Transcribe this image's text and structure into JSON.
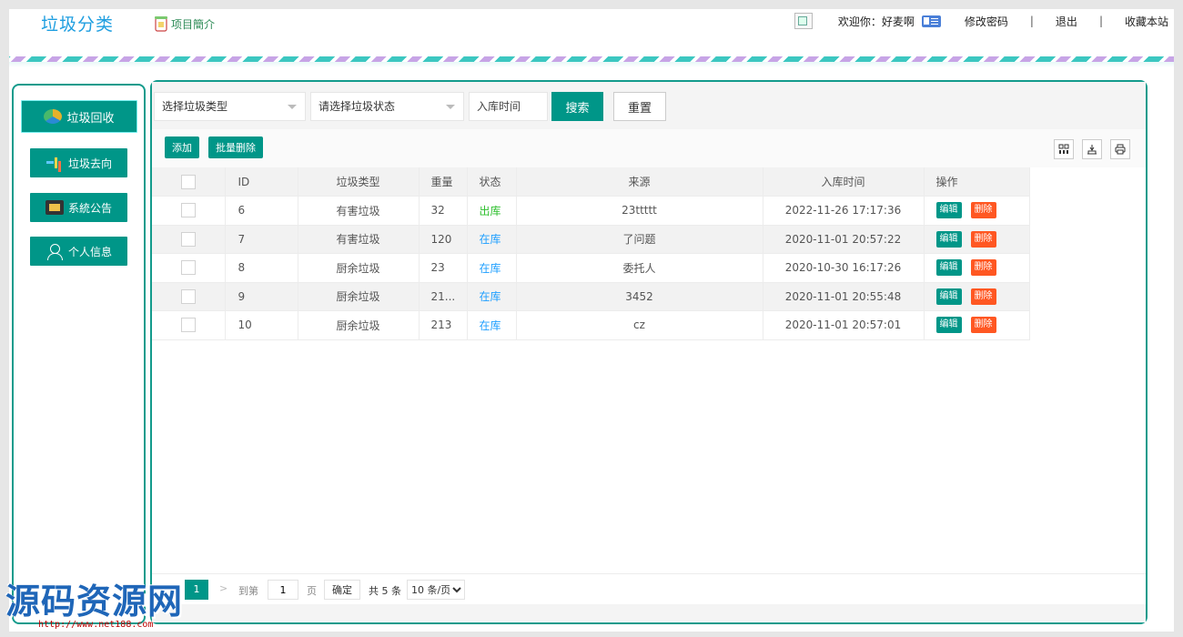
{
  "header": {
    "logo": "垃圾分类",
    "project_intro": "项目簡介",
    "welcome": "欢迎你：好麦啊",
    "change_password": "修改密码",
    "separator": "|",
    "logout": "退出",
    "bookmark": "收藏本站"
  },
  "sidebar": {
    "items": [
      {
        "label": "垃圾回收",
        "icon": "recycle-icon"
      },
      {
        "label": "垃圾去向",
        "icon": "route-icon"
      },
      {
        "label": "系統公告",
        "icon": "notice-icon"
      },
      {
        "label": "个人信息",
        "icon": "user-icon"
      }
    ]
  },
  "search": {
    "type_placeholder": "选择垃圾类型",
    "status_placeholder": "请选择垃圾状态",
    "date_placeholder": "入库时间",
    "search_label": "搜索",
    "reset_label": "重置"
  },
  "toolbar": {
    "add_label": "添加",
    "batch_delete_label": "批量删除"
  },
  "table": {
    "headers": [
      "ID",
      "垃圾类型",
      "重量",
      "状态",
      "来源",
      "入库时间",
      "操作"
    ],
    "rows": [
      {
        "id": "6",
        "type": "有害垃圾",
        "weight": "32",
        "status": "出库",
        "source": "23ttttt",
        "time": "2022-11-26 17:17:36"
      },
      {
        "id": "7",
        "type": "有害垃圾",
        "weight": "120",
        "status": "在库",
        "source": "了问题",
        "time": "2020-11-01 20:57:22"
      },
      {
        "id": "8",
        "type": "厨余垃圾",
        "weight": "23",
        "status": "在库",
        "source": "委托人",
        "time": "2020-10-30 16:17:26"
      },
      {
        "id": "9",
        "type": "厨余垃圾",
        "weight": "21...",
        "status": "在库",
        "source": "3452",
        "time": "2020-11-01 20:55:48"
      },
      {
        "id": "10",
        "type": "厨余垃圾",
        "weight": "213",
        "status": "在库",
        "source": "cz",
        "time": "2020-11-01 20:57:01"
      }
    ],
    "edit_label": "编辑",
    "delete_label": "删除"
  },
  "pager": {
    "current_page": "1",
    "next": ">",
    "goto_label": "到第",
    "page_input": "1",
    "page_unit": "页",
    "confirm": "确定",
    "total": "共 5 条",
    "page_size": "10 条/页"
  },
  "watermark": {
    "text": "源码资源网",
    "url": "http://www.net188.com"
  },
  "colors": {
    "accent": "#009688",
    "frame_border": "#139b8c",
    "danger": "#ff5722",
    "status_out": "#2dbf2d",
    "status_in": "#1e9fff",
    "logo": "#1e9ee0"
  }
}
